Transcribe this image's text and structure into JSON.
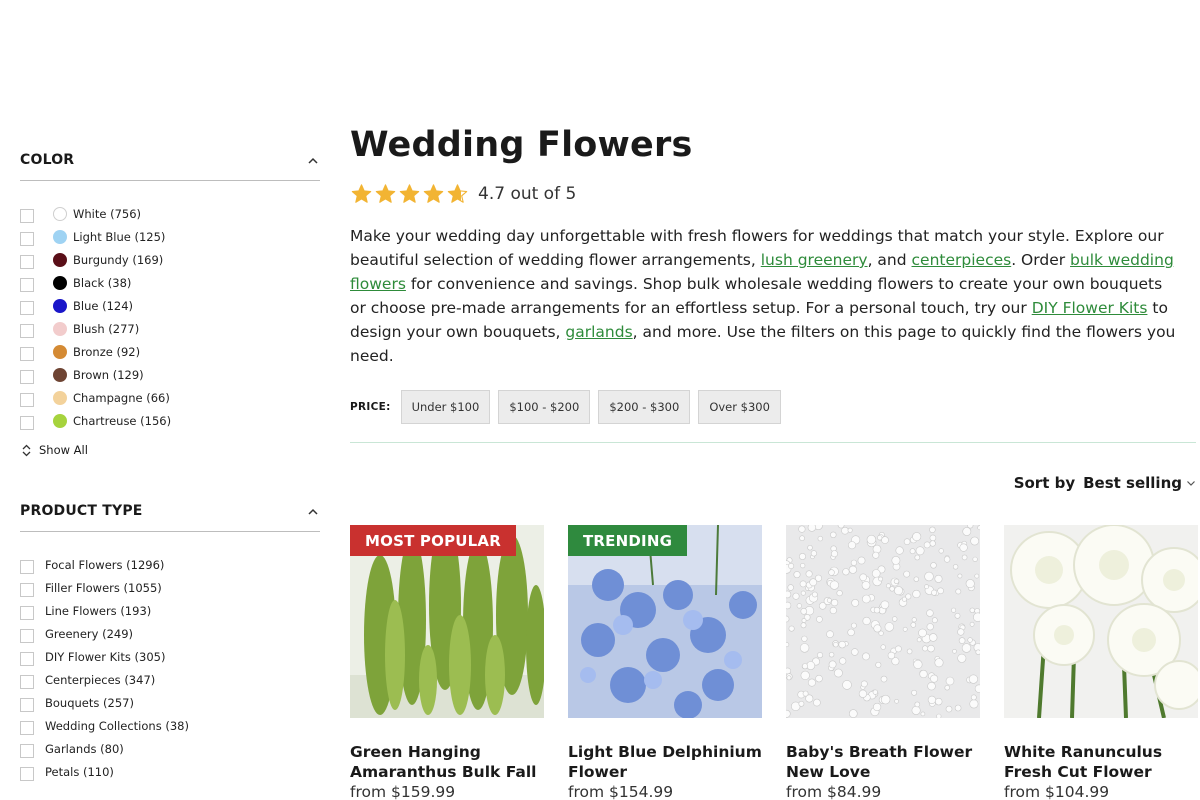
{
  "colors": {
    "accent_green": "#2e8b3a",
    "badge_popular": "#c9312f",
    "badge_trending": "#2f8a3e",
    "star": "#f2b433"
  },
  "sidebar": {
    "color": {
      "title": "COLOR",
      "items": [
        {
          "label": "White (756)",
          "swatch": "#ffffff"
        },
        {
          "label": "Light Blue (125)",
          "swatch": "#9fd3f3"
        },
        {
          "label": "Burgundy (169)",
          "swatch": "#5a0f18"
        },
        {
          "label": "Black (38)",
          "swatch": "#000000"
        },
        {
          "label": "Blue (124)",
          "swatch": "#1a16c9"
        },
        {
          "label": "Blush (277)",
          "swatch": "#f2cccc"
        },
        {
          "label": "Bronze (92)",
          "swatch": "#d48a34"
        },
        {
          "label": "Brown (129)",
          "swatch": "#6e4433"
        },
        {
          "label": "Champagne (66)",
          "swatch": "#f3d29b"
        },
        {
          "label": "Chartreuse (156)",
          "swatch": "#a6d33d"
        }
      ],
      "show_all": "Show All"
    },
    "product_type": {
      "title": "PRODUCT TYPE",
      "items": [
        {
          "label": "Focal Flowers (1296)"
        },
        {
          "label": "Filler Flowers (1055)"
        },
        {
          "label": "Line Flowers (193)"
        },
        {
          "label": "Greenery (249)"
        },
        {
          "label": "DIY Flower Kits (305)"
        },
        {
          "label": "Centerpieces (347)"
        },
        {
          "label": "Bouquets (257)"
        },
        {
          "label": "Wedding Collections (38)"
        },
        {
          "label": "Garlands (80)"
        },
        {
          "label": "Petals (110)"
        }
      ]
    }
  },
  "main": {
    "title": "Wedding Flowers",
    "rating": {
      "value": 4.7,
      "text": "4.7 out of 5"
    },
    "description": {
      "t1": "Make your wedding day unforgettable with fresh flowers for weddings that match your style. Explore our beautiful selection of wedding flower arrangements, ",
      "l1": "lush greenery",
      "t2": ", and ",
      "l2": "centerpieces",
      "t3": ". Order ",
      "l3": "bulk wedding flowers",
      "t4": " for convenience and savings. Shop bulk wholesale wedding flowers to create your own bouquets or choose pre-made arrangements for an effortless setup. For a personal touch, try our ",
      "l4": "DIY Flower Kits",
      "t5": " to design your own bouquets, ",
      "l5": "garlands",
      "t6": ", and more. Use the filters on this page to quickly find the flowers you need."
    },
    "price": {
      "label": "PRICE:",
      "options": [
        "Under $100",
        "$100 - $200",
        "$200 - $300",
        "Over $300"
      ]
    },
    "sort": {
      "label": "Sort by",
      "value": "Best selling"
    },
    "products": [
      {
        "name": "Green Hanging Amaranthus Bulk Fall ...",
        "price": "from $159.99",
        "badge": "MOST POPULAR",
        "image": "green-amaranthus"
      },
      {
        "name": "Light Blue Delphinium Flower",
        "price": "from $154.99",
        "badge": "TRENDING",
        "image": "blue-delphinium"
      },
      {
        "name": "Baby's Breath Flower New Love",
        "price": "from $84.99",
        "badge": "",
        "image": "babys-breath"
      },
      {
        "name": "White Ranunculus Fresh Cut Flower",
        "price": "from $104.99",
        "badge": "",
        "image": "white-ranunculus"
      }
    ]
  }
}
